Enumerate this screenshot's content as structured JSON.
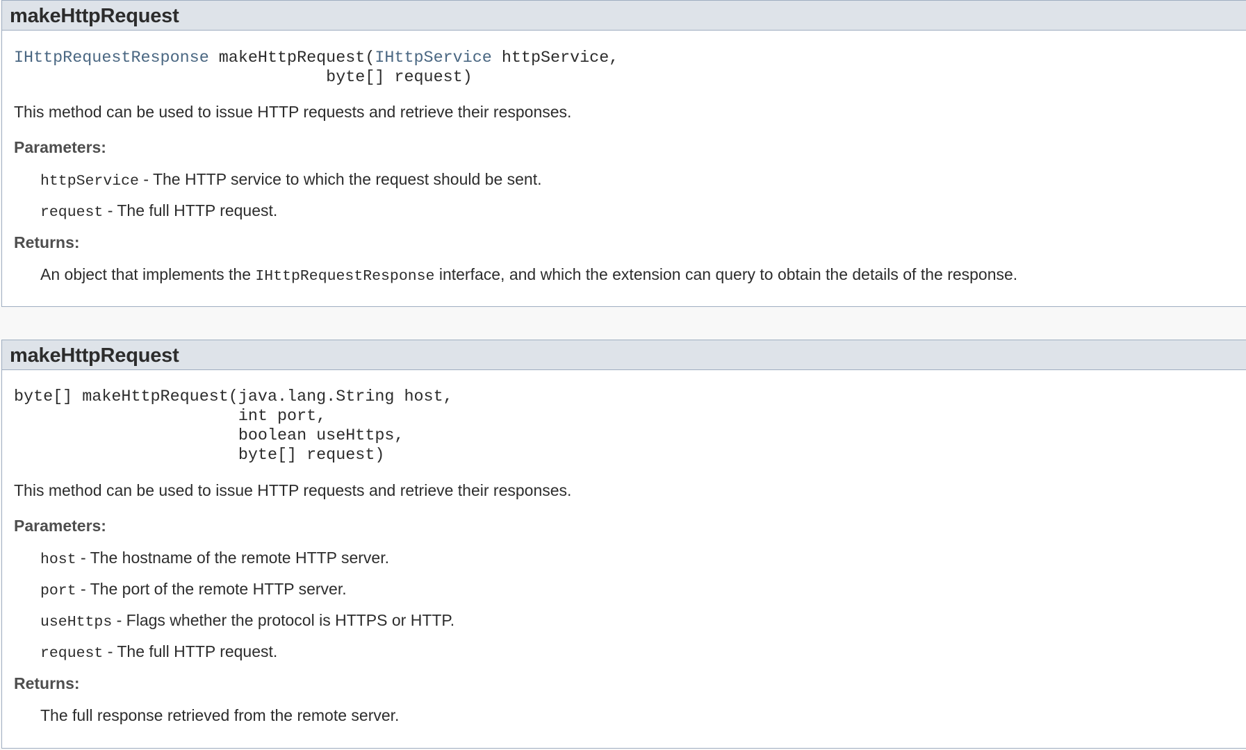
{
  "methods": [
    {
      "name": "makeHttpRequest",
      "signature": {
        "return_type": "IHttpRequestResponse",
        "method_name": " makeHttpRequest(",
        "param1_type": "IHttpService",
        "param1_rest": " httpService,",
        "line2": "                                byte[] request)"
      },
      "description": "This method can be used to issue HTTP requests and retrieve their responses.",
      "parameters_label": "Parameters:",
      "parameters": [
        {
          "name": "httpService",
          "text": " - The HTTP service to which the request should be sent."
        },
        {
          "name": "request",
          "text": " - The full HTTP request."
        }
      ],
      "returns_label": "Returns:",
      "returns": {
        "prefix": "An object that implements the ",
        "code": "IHttpRequestResponse",
        "suffix": " interface, and which the extension can query to obtain the details of the response."
      }
    },
    {
      "name": "makeHttpRequest",
      "signature": {
        "lines": [
          "byte[] makeHttpRequest(java.lang.String host,",
          "                       int port,",
          "                       boolean useHttps,",
          "                       byte[] request)"
        ]
      },
      "description": "This method can be used to issue HTTP requests and retrieve their responses.",
      "parameters_label": "Parameters:",
      "parameters": [
        {
          "name": "host",
          "text": " - The hostname of the remote HTTP server."
        },
        {
          "name": "port",
          "text": " - The port of the remote HTTP server."
        },
        {
          "name": "useHttps",
          "text": " - Flags whether the protocol is HTTPS or HTTP."
        },
        {
          "name": "request",
          "text": " - The full HTTP request."
        }
      ],
      "returns_label": "Returns:",
      "returns": {
        "text": "The full response retrieved from the remote server."
      }
    }
  ]
}
